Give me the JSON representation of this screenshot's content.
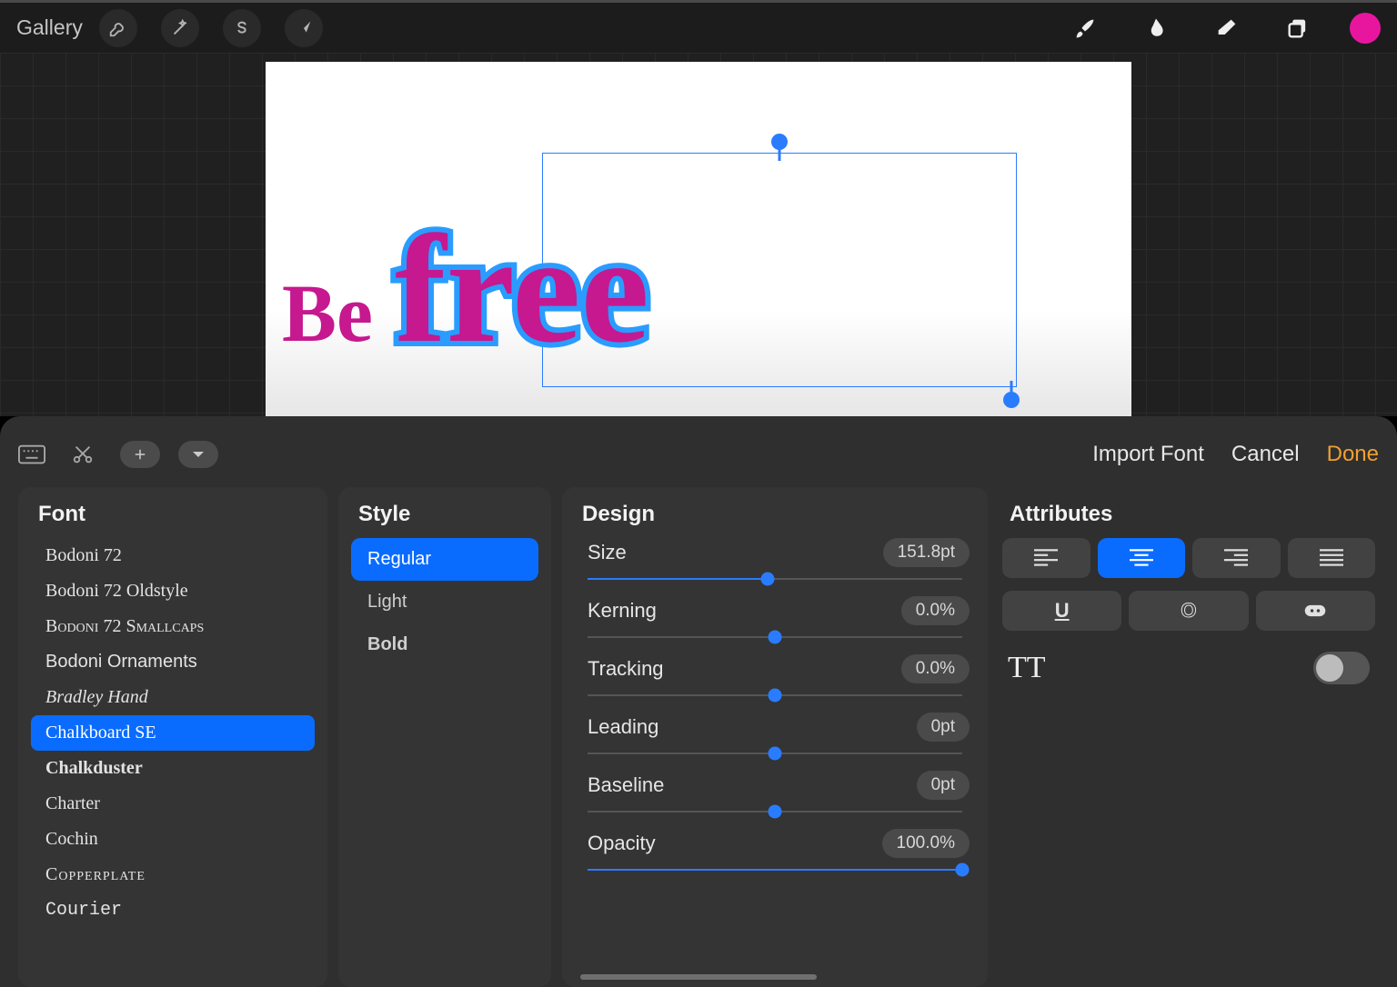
{
  "topbar": {
    "gallery_label": "Gallery"
  },
  "canvas": {
    "text_be": "Be",
    "text_free": "free"
  },
  "text_panel": {
    "actions": {
      "import_font": "Import Font",
      "cancel": "Cancel",
      "done": "Done"
    },
    "font": {
      "title": "Font",
      "items": [
        "Bodoni 72",
        "Bodoni 72 Oldstyle",
        "Bodoni 72 Smallcaps",
        "Bodoni Ornaments",
        "Bradley Hand",
        "Chalkboard SE",
        "Chalkduster",
        "Charter",
        "Cochin",
        "Copperplate",
        "Courier"
      ],
      "selected": "Chalkboard SE"
    },
    "style": {
      "title": "Style",
      "items": [
        "Regular",
        "Light",
        "Bold"
      ],
      "selected": "Regular"
    },
    "design": {
      "title": "Design",
      "size": {
        "label": "Size",
        "value": "151.8pt",
        "percent": 48
      },
      "kerning": {
        "label": "Kerning",
        "value": "0.0%",
        "percent": 50
      },
      "tracking": {
        "label": "Tracking",
        "value": "0.0%",
        "percent": 50
      },
      "leading": {
        "label": "Leading",
        "value": "0pt",
        "percent": 50
      },
      "baseline": {
        "label": "Baseline",
        "value": "0pt",
        "percent": 50
      },
      "opacity": {
        "label": "Opacity",
        "value": "100.0%",
        "percent": 100
      }
    },
    "attributes": {
      "title": "Attributes",
      "tt_label": "TT",
      "alignment_selected": "center",
      "caps_toggle": false
    }
  },
  "colors": {
    "accent_blue": "#0a6cff",
    "accent_orange": "#f0a030",
    "brand_pink": "#e8169e"
  }
}
